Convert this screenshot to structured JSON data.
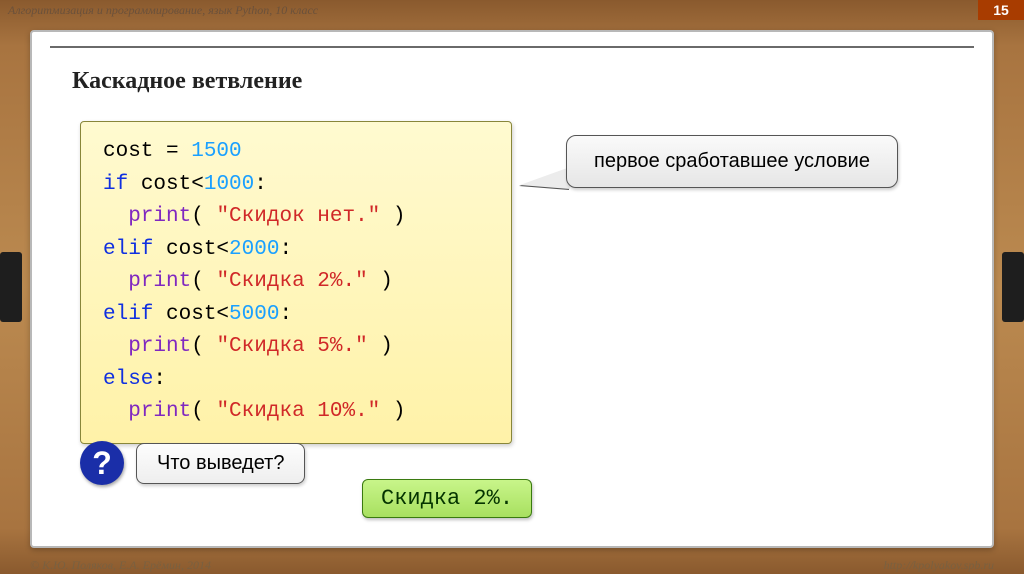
{
  "header": {
    "breadcrumb": "Алгоритмизация и программирование, язык Python, 10 класс",
    "page_number": "15"
  },
  "slide": {
    "title": "Каскадное ветвление",
    "code": {
      "l1a": "cost = ",
      "l1b": "1500",
      "l2a": "if",
      "l2b": " cost<",
      "l2c": "1000",
      "l2d": ":",
      "l3a": "  ",
      "l3b": "print",
      "l3c": "( ",
      "l3d": "\"Скидок нет.\"",
      "l3e": " )",
      "l4a": "elif",
      "l4b": " cost<",
      "l4c": "2000",
      "l4d": ":",
      "l5a": "  ",
      "l5b": "print",
      "l5c": "( ",
      "l5d": "\"Скидка 2%.\"",
      "l5e": " )",
      "l6a": "elif",
      "l6b": " cost<",
      "l6c": "5000",
      "l6d": ":",
      "l7a": "  ",
      "l7b": "print",
      "l7c": "( ",
      "l7d": "\"Скидка 5%.\"",
      "l7e": " )",
      "l8a": "else",
      "l8b": ":",
      "l9a": "  ",
      "l9b": "print",
      "l9c": "( ",
      "l9d": "\"Скидка 10%.\"",
      "l9e": " )"
    },
    "callout": "первое сработавшее условие",
    "question_mark": "?",
    "question": "Что выведет?",
    "answer": "Скидка 2%."
  },
  "footer": {
    "left": "© К.Ю. Поляков, Е.А. Ерёмин, 2014",
    "right": "http://kpolyakov.spb.ru"
  }
}
